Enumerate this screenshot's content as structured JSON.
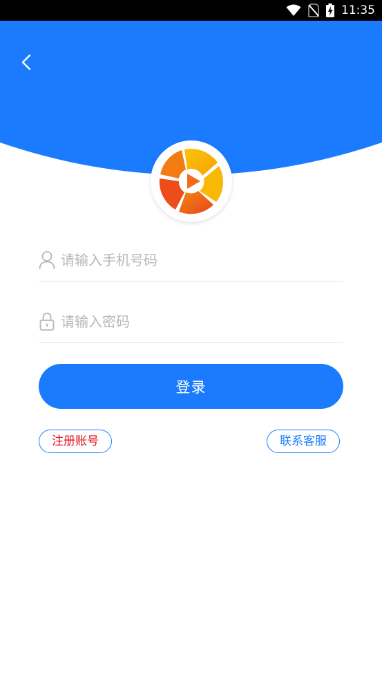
{
  "status_bar": {
    "time": "11:35",
    "icons": [
      "wifi-icon",
      "no-sim-icon",
      "battery-charging-icon"
    ]
  },
  "header": {
    "back_icon": "chevron-left-icon",
    "color": "#1a7bff"
  },
  "logo": {
    "icon": "camera-aperture-play-logo",
    "colors": [
      "#f7b500",
      "#f36b16",
      "#e83a1b"
    ]
  },
  "form": {
    "phone": {
      "icon": "user-icon",
      "placeholder": "请输入手机号码",
      "value": ""
    },
    "password": {
      "icon": "lock-icon",
      "placeholder": "请输入密码",
      "value": ""
    },
    "login_label": "登录"
  },
  "links": {
    "register_label": "注册账号",
    "contact_label": "联系客服"
  },
  "colors": {
    "primary": "#1a7bff",
    "register_text": "#e4101f",
    "placeholder": "#b7b7b7"
  }
}
